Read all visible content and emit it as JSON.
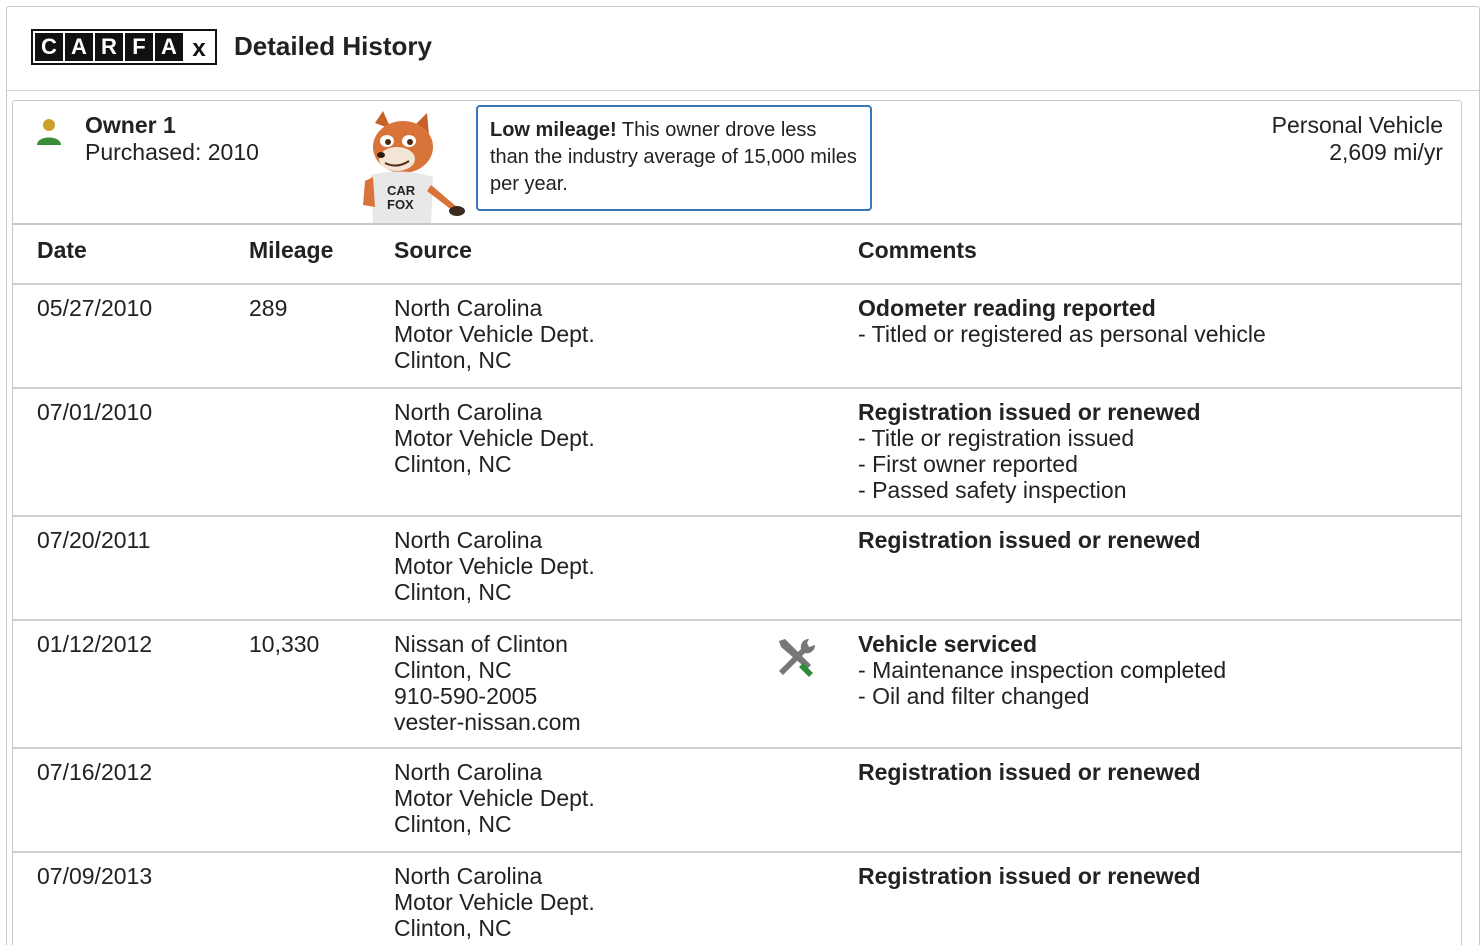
{
  "header": {
    "logo_letters": [
      "C",
      "A",
      "R",
      "F",
      "A"
    ],
    "logo_x": "x",
    "title": "Detailed History"
  },
  "owner": {
    "name": "Owner 1",
    "purchased": "Purchased: 2010",
    "vehicle_type": "Personal Vehicle",
    "mileage_per_year": "2,609 mi/yr",
    "callout_bold": "Low mileage!",
    "callout_text": " This owner drove less than the industry average of 15,000 miles per year."
  },
  "table": {
    "headers": {
      "date": "Date",
      "mileage": "Mileage",
      "source": "Source",
      "comments": "Comments"
    },
    "rows": [
      {
        "date": "05/27/2010",
        "mileage": "289",
        "source": [
          "North Carolina",
          "Motor Vehicle Dept.",
          "Clinton, NC"
        ],
        "icon": "",
        "comment_title": "Odometer reading reported",
        "comment_items": [
          "Titled or registered as personal vehicle"
        ]
      },
      {
        "date": "07/01/2010",
        "mileage": "",
        "source": [
          "North Carolina",
          "Motor Vehicle Dept.",
          "Clinton, NC"
        ],
        "icon": "",
        "comment_title": "Registration issued or renewed",
        "comment_items": [
          "Title or registration issued",
          "First owner reported",
          "Passed safety inspection"
        ]
      },
      {
        "date": "07/20/2011",
        "mileage": "",
        "source": [
          "North Carolina",
          "Motor Vehicle Dept.",
          "Clinton, NC"
        ],
        "icon": "",
        "comment_title": "Registration issued or renewed",
        "comment_items": []
      },
      {
        "date": "01/12/2012",
        "mileage": "10,330",
        "source": [
          "Nissan of Clinton",
          "Clinton, NC",
          "910-590-2005",
          "vester-nissan.com"
        ],
        "icon": "wrench-screwdriver-icon",
        "comment_title": "Vehicle serviced",
        "comment_items": [
          "Maintenance inspection completed",
          "Oil and filter changed"
        ]
      },
      {
        "date": "07/16/2012",
        "mileage": "",
        "source": [
          "North Carolina",
          "Motor Vehicle Dept.",
          "Clinton, NC"
        ],
        "icon": "",
        "comment_title": "Registration issued or renewed",
        "comment_items": []
      },
      {
        "date": "07/09/2013",
        "mileage": "",
        "source": [
          "North Carolina",
          "Motor Vehicle Dept.",
          "Clinton, NC"
        ],
        "icon": "",
        "comment_title": "Registration issued or renewed",
        "comment_items": []
      }
    ]
  },
  "colors": {
    "person_icon_head": "#c9a227",
    "person_icon_body": "#3a8c3a",
    "callout_border": "#3777bc",
    "service_icon_green": "#2e8b3a",
    "service_icon_gray": "#777777"
  }
}
